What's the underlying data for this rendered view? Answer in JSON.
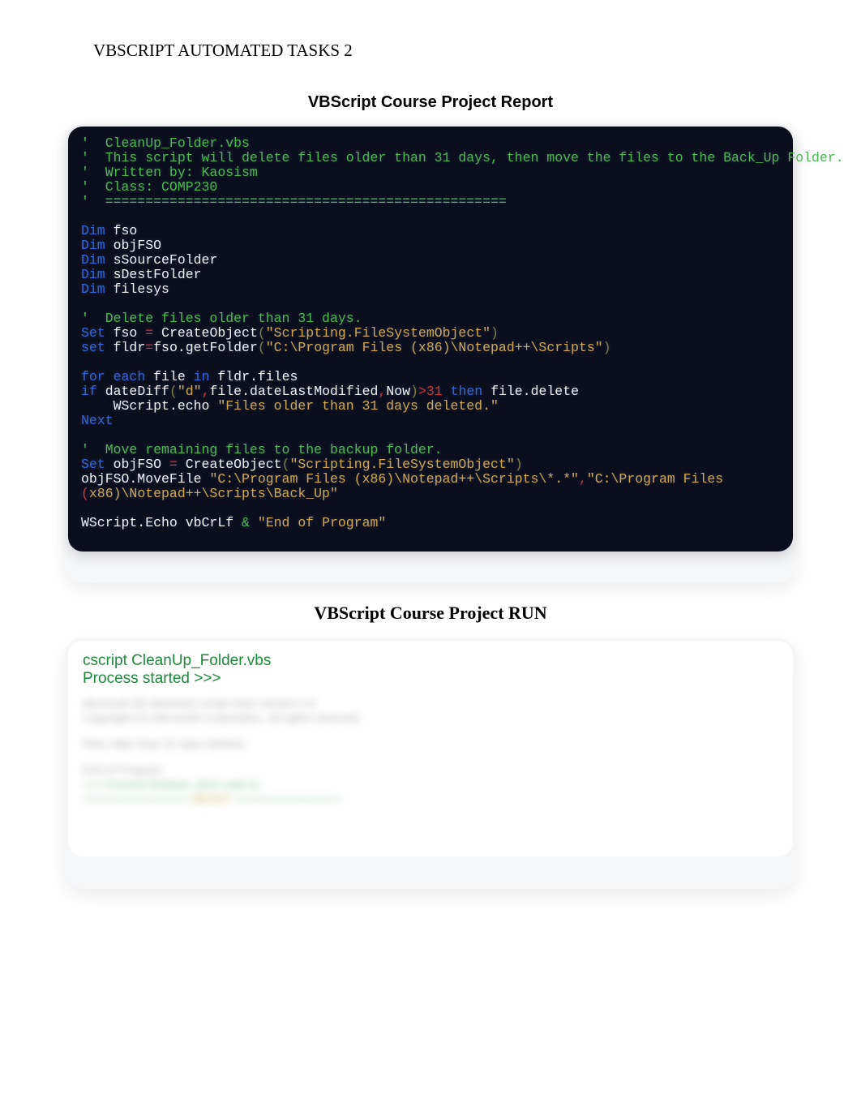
{
  "header": "VBSCRIPT AUTOMATED TASKS  2",
  "title1": "VBScript Course Project Report",
  "title2": "VBScript Course Project RUN",
  "code": {
    "l1": "'  CleanUp_Folder.vbs",
    "l2": "'  This script will delete files older than 31 days, then move the files to the Back_Up Folder.",
    "l3": "'  Written by: Kaosism",
    "l4": "'  Class: COMP230",
    "l5": "'  ==================================================",
    "dim": "Dim",
    "v1": " fso",
    "v2": " objFSO",
    "v3": " sSourceFolder",
    "v4": " sDestFolder",
    "v5": " filesys",
    "c_delete": "'  Delete files older than 31 days.",
    "set": "Set",
    "set_lc": "set",
    "fso_eq": " fso ",
    "eq": "=",
    "createobj": " CreateObject",
    "lparen": "(",
    "rparen": ")",
    "str_fso": "\"Scripting.FileSystemObject\"",
    "fldr_eq": " fldr",
    "getfolder": "fso.getFolder",
    "str_path1": "\"C:\\Program Files (x86)\\Notepad++\\Scripts\"",
    "for": "for",
    "each": "each",
    "file_in": " file ",
    "in": "in",
    "fldr_files": " fldr.files",
    "if": "if",
    "datediff": " dateDiff",
    "str_d": "\"d\"",
    "comma": ",",
    "dlm": "file.dateLastModified",
    "now": "Now",
    "gt31": ">",
    "n31": "31",
    "then": "then",
    "file_delete": " file.delete",
    "wse_indent": "    WScript.echo ",
    "str_deleted": "\"Files older than 31 days deleted.\"",
    "next": "Next",
    "c_move": "'  Move remaining files to the backup folder.",
    "objfso_eq": " objFSO ",
    "movefile": "objFSO.MoveFile ",
    "str_src": "\"C:\\Program Files (x86)\\Notepad++\\Scripts\\*.*\"",
    "str_dst_part1": "\"C:\\Program Files ",
    "str_dst_part2": "x86)\\Notepad++\\Scripts\\Back_Up\"",
    "lparen_red": "(",
    "wse2": "WScript.Echo vbCrLf ",
    "amp": "&",
    "str_end": " \"End of Program\""
  },
  "run": {
    "l1": "cscript CleanUp_Folder.vbs",
    "l2": "Process started >>>",
    "b1": "Microsoft (R) Windows Script Host Version 5.8",
    "b2": "Copyright (C) Microsoft Corporation. All rights reserved.",
    "b3": "Files older than 31 days deleted.",
    "b4": "End of Program",
    "b5_a": "<<< Process finished. (Exit code 0)",
    "b5_b": "================ ",
    "b5_c": "READY",
    "b5_d": " ================"
  }
}
